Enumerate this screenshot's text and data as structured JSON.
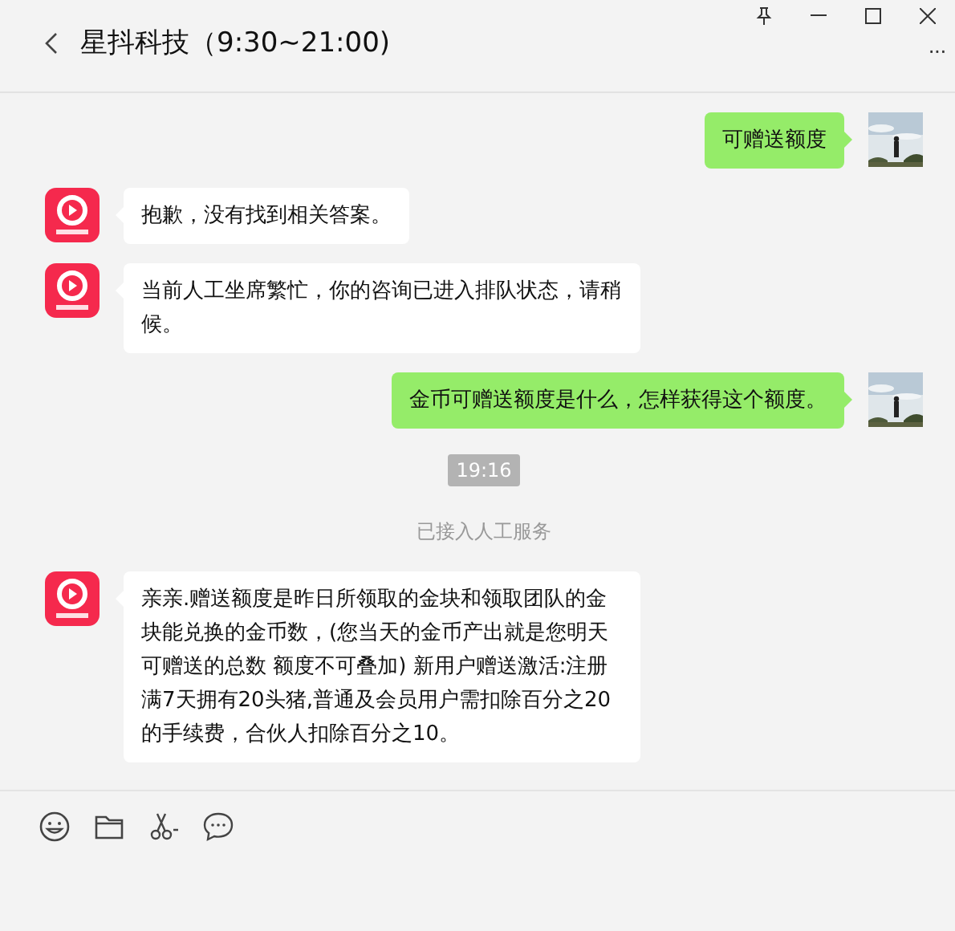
{
  "window": {
    "title": "星抖科技（9:30~21:00)",
    "more": "···"
  },
  "messages": [
    {
      "kind": "out",
      "text": "可赠送额度"
    },
    {
      "kind": "in",
      "text": "抱歉，没有找到相关答案。"
    },
    {
      "kind": "in",
      "text": "当前人工坐席繁忙，你的咨询已进入排队状态，请稍候。"
    },
    {
      "kind": "out",
      "text": "金币可赠送额度是什么，怎样获得这个额度。"
    },
    {
      "kind": "time",
      "text": "19:16"
    },
    {
      "kind": "notice",
      "text": "已接入人工服务"
    },
    {
      "kind": "in",
      "text": "亲亲.赠送额度是昨日所领取的金块和领取团队的金块能兑换的金币数，(您当天的金币产出就是您明天可赠送的总数  额度不可叠加)    新用户赠送激活:注册满7天拥有20头猪,普通及会员用户需扣除百分之20的手续费，合伙人扣除百分之10。"
    }
  ]
}
